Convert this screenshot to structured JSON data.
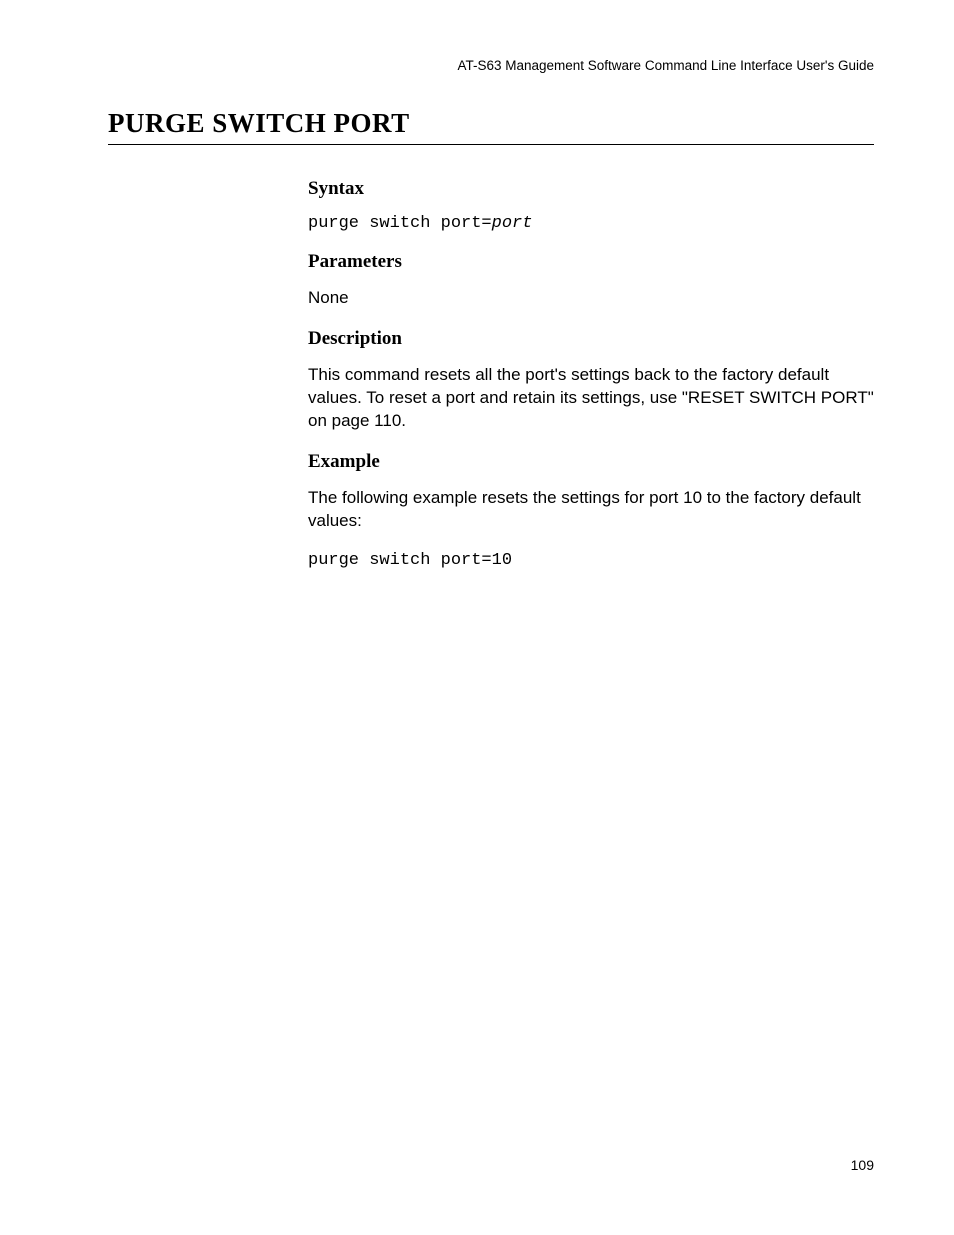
{
  "header": {
    "guide_title": "AT-S63 Management Software Command Line Interface User's Guide"
  },
  "title": "PURGE SWITCH PORT",
  "sections": {
    "syntax": {
      "heading": "Syntax",
      "command_prefix": "purge switch port=",
      "command_arg": "port"
    },
    "parameters": {
      "heading": "Parameters",
      "text": "None"
    },
    "description": {
      "heading": "Description",
      "text": "This command resets all the port's settings back to the factory default values. To reset a port and retain its settings, use \"RESET SWITCH PORT\" on page 110."
    },
    "example": {
      "heading": "Example",
      "intro": "The following example resets the settings for port 10 to the factory default values:",
      "command": "purge switch port=10"
    }
  },
  "page_number": "109"
}
